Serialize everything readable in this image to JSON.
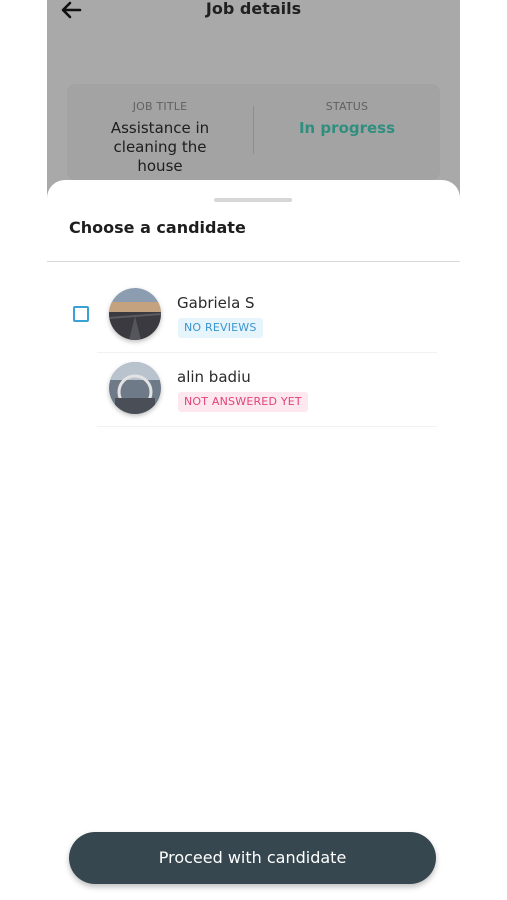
{
  "header": {
    "title": "Job details",
    "back_icon": "arrow-left-icon"
  },
  "summary": {
    "job_title_caption": "JOB TITLE",
    "job_title_value": "Assistance in cleaning the house",
    "status_caption": "STATUS",
    "status_value": "In progress",
    "status_color": "#2f8f7e"
  },
  "sheet": {
    "title": "Choose a candidate",
    "candidates": [
      {
        "name": "Gabriela S",
        "badge": "NO REVIEWS",
        "badge_color": "#3a95cf",
        "checkbox": true,
        "checked": false
      },
      {
        "name": "alin badiu",
        "badge": "NOT ANSWERED YET",
        "badge_color": "#e2437a",
        "checkbox": false
      }
    ]
  },
  "footer": {
    "proceed_label": "Proceed with candidate"
  }
}
